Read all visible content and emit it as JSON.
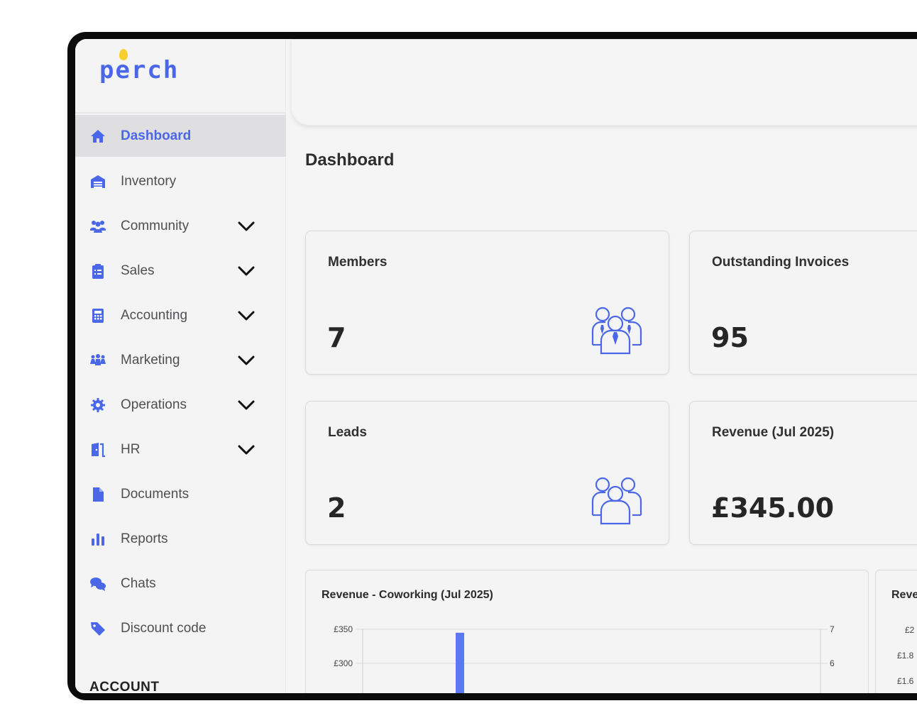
{
  "brand": {
    "name": "perch",
    "accent": "#4a67e8",
    "pin_color": "#f6cf2a"
  },
  "sidebar": {
    "items": [
      {
        "label": "Dashboard",
        "icon": "home-icon",
        "active": true,
        "has_submenu": false
      },
      {
        "label": "Inventory",
        "icon": "warehouse-icon",
        "active": false,
        "has_submenu": false
      },
      {
        "label": "Community",
        "icon": "users-icon",
        "active": false,
        "has_submenu": true
      },
      {
        "label": "Sales",
        "icon": "clipboard-icon",
        "active": false,
        "has_submenu": true
      },
      {
        "label": "Accounting",
        "icon": "calculator-icon",
        "active": false,
        "has_submenu": true
      },
      {
        "label": "Marketing",
        "icon": "people-group-icon",
        "active": false,
        "has_submenu": true
      },
      {
        "label": "Operations",
        "icon": "gear-icon",
        "active": false,
        "has_submenu": true
      },
      {
        "label": "HR",
        "icon": "door-icon",
        "active": false,
        "has_submenu": true
      },
      {
        "label": "Documents",
        "icon": "file-icon",
        "active": false,
        "has_submenu": false
      },
      {
        "label": "Reports",
        "icon": "bar-chart-icon",
        "active": false,
        "has_submenu": false
      },
      {
        "label": "Chats",
        "icon": "chat-bubbles-icon",
        "active": false,
        "has_submenu": false
      },
      {
        "label": "Discount code",
        "icon": "tag-icon",
        "active": false,
        "has_submenu": false
      }
    ],
    "section_label": "ACCOUNT"
  },
  "main": {
    "title": "Dashboard",
    "cards": [
      {
        "title": "Members",
        "value": "7",
        "icon": "team-icon"
      },
      {
        "title": "Outstanding Invoices",
        "value": "95",
        "icon": ""
      },
      {
        "title": "Leads",
        "value": "2",
        "icon": "group-icon"
      },
      {
        "title": "Revenue (Jul 2025)",
        "value": "£345.00",
        "icon": ""
      }
    ],
    "charts": [
      {
        "title": "Revenue - Coworking (Jul 2025)"
      },
      {
        "title": "Reve"
      }
    ]
  },
  "chart_data": [
    {
      "type": "bar",
      "title": "Revenue - Coworking (Jul 2025)",
      "y_left_ticks": [
        "£350",
        "£300"
      ],
      "y_right_ticks": [
        "7",
        "6"
      ],
      "ylim": [
        0,
        350
      ],
      "series": [
        {
          "values": [
            345
          ]
        }
      ],
      "bar_color": "#5b78f0"
    },
    {
      "type": "bar",
      "title": "Reve",
      "y_left_ticks": [
        "£2",
        "£1.8",
        "£1.6"
      ]
    }
  ]
}
